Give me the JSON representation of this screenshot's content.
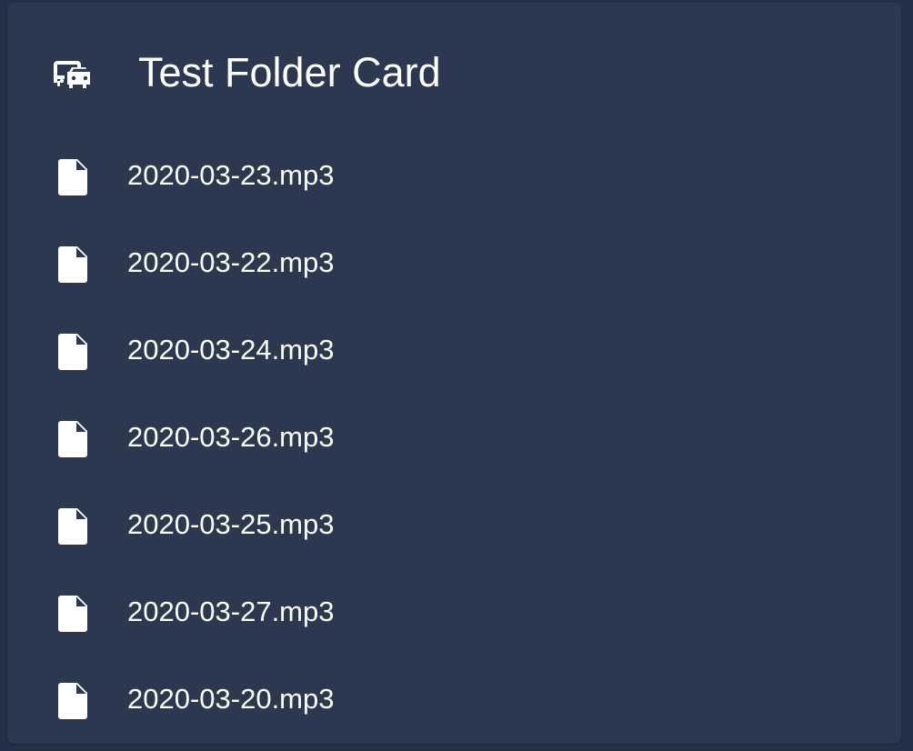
{
  "card": {
    "title": "Test Folder Card",
    "icon": "bus-car-icon"
  },
  "files": [
    {
      "name": "2020-03-23.mp3",
      "icon": "file-icon"
    },
    {
      "name": "2020-03-22.mp3",
      "icon": "file-icon"
    },
    {
      "name": "2020-03-24.mp3",
      "icon": "file-icon"
    },
    {
      "name": "2020-03-26.mp3",
      "icon": "file-icon"
    },
    {
      "name": "2020-03-25.mp3",
      "icon": "file-icon"
    },
    {
      "name": "2020-03-27.mp3",
      "icon": "file-icon"
    },
    {
      "name": "2020-03-20.mp3",
      "icon": "file-icon"
    }
  ],
  "colors": {
    "page_background": "#243047",
    "card_background": "#2c3850",
    "text": "#ffffff"
  }
}
